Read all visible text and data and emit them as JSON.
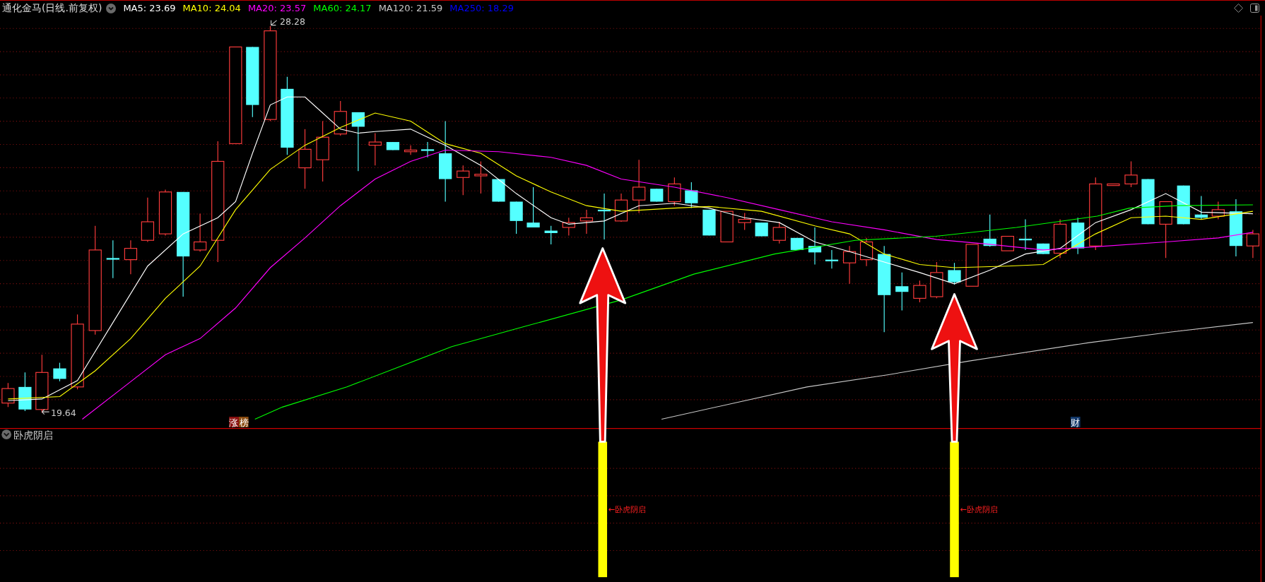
{
  "title": "通化金马(日线.前复权)",
  "ma_legend": [
    {
      "label": "MA5: 23.69",
      "color": "#ffffff"
    },
    {
      "label": "MA10: 24.04",
      "color": "#ffff00"
    },
    {
      "label": "MA20: 23.57",
      "color": "#ff00ff"
    },
    {
      "label": "MA60: 24.17",
      "color": "#00ff00"
    },
    {
      "label": "MA120: 21.59",
      "color": "#c8c8c8"
    },
    {
      "label": "MA250: 18.29",
      "color": "#0000ff"
    }
  ],
  "price_chart": {
    "high_label": "28.28",
    "low_label": "19.64",
    "badges": [
      {
        "text": "涨榜",
        "kind": "limit"
      },
      {
        "text": "财",
        "kind": "finance"
      }
    ]
  },
  "indicator": {
    "name": "卧虎阴启",
    "signals": [
      {
        "label": "←卧虎阴启"
      },
      {
        "label": "←卧虎阴启"
      }
    ]
  }
}
